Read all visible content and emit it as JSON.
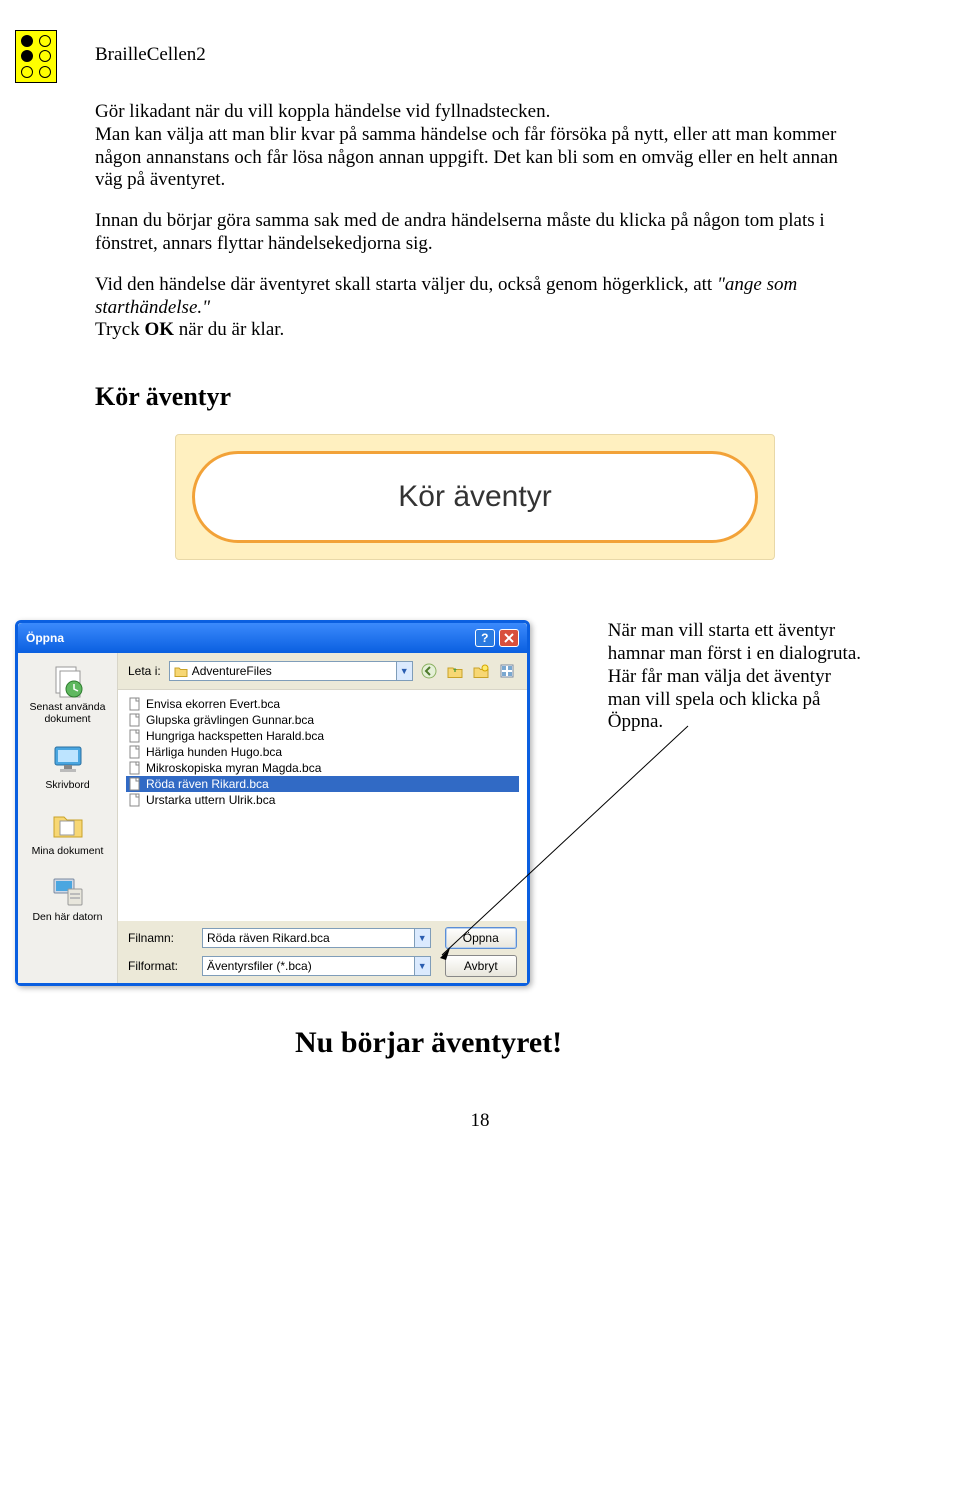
{
  "header": {
    "docTitle": "BrailleCellen2"
  },
  "text": {
    "p1a": "Gör likadant när du vill koppla händelse vid fyllnadstecken.",
    "p1b": "Man kan välja att man blir kvar på samma händelse och får försöka på nytt, eller att man kommer någon annanstans och får lösa någon annan uppgift. Det kan bli som en omväg eller en helt annan väg på äventyret.",
    "p2": "Innan du börjar göra samma sak med de andra händelserna måste du klicka på någon tom plats i fönstret, annars flyttar händelsekedjorna sig.",
    "p3a": "Vid den händelse där äventyret skall starta väljer du, också genom högerklick, att ",
    "p3i": "\"ange som starthändelse.\"",
    "p3b": "Tryck ",
    "p3bold": "OK",
    "p3c": " när du är klar.",
    "h2": "Kör äventyr",
    "bigButton": "Kör äventyr",
    "side1": "När man vill starta ett äventyr hamnar man först i en dialogruta.",
    "side2": "Här får man välja det äventyr man vill spela och klicka på Öppna.",
    "finalHeading": "Nu börjar äventyret!",
    "pageNum": "18"
  },
  "dialog": {
    "title": "Öppna",
    "lookInLabel": "Leta i:",
    "folder": "AdventureFiles",
    "places": {
      "recent": "Senast använda dokument",
      "desktop": "Skrivbord",
      "mydocs": "Mina dokument",
      "mycomp": "Den här datorn"
    },
    "files": [
      "Envisa ekorren Evert.bca",
      "Glupska grävlingen Gunnar.bca",
      "Hungriga hackspetten Harald.bca",
      "Härliga hunden Hugo.bca",
      "Mikroskopiska myran Magda.bca",
      "Röda räven Rikard.bca",
      "Urstarka uttern Ulrik.bca"
    ],
    "selectedIndex": 5,
    "filenameLabel": "Filnamn:",
    "filename": "Röda räven Rikard.bca",
    "filetypeLabel": "Filformat:",
    "filetype": "Äventyrsfiler (*.bca)",
    "openBtn": "Öppna",
    "cancelBtn": "Avbryt"
  }
}
